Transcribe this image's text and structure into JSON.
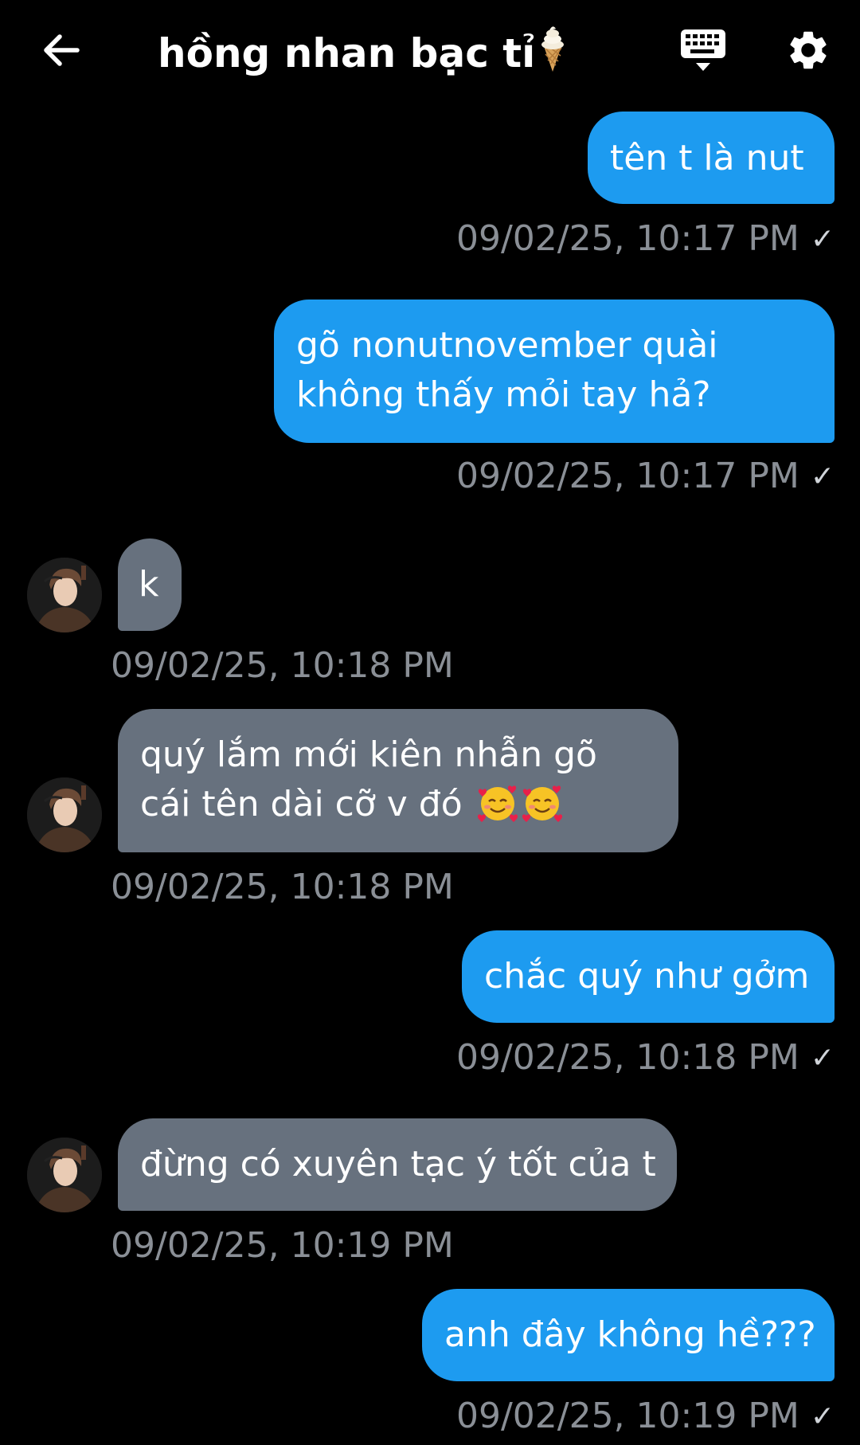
{
  "header": {
    "back_icon": "arrow-left-icon",
    "title": "hồng nhan bạc tỉ",
    "title_emoji": "soft-ice-cream-icon",
    "keyboard_icon": "keyboard-icon",
    "settings_icon": "gear-icon"
  },
  "colors": {
    "background": "#000000",
    "sent_bubble": "#1d9bf0",
    "received_bubble": "#67717e",
    "timestamp": "#8a8f96"
  },
  "messages": [
    {
      "direction": "sent",
      "text": "tên t là nut",
      "time": "09/02/25, 10:17 PM",
      "read_check": "✓"
    },
    {
      "direction": "sent",
      "line1": "gõ nonutnovember quài",
      "line2": "không thấy mỏi tay hả?",
      "time": "09/02/25, 10:17 PM",
      "read_check": "✓"
    },
    {
      "direction": "received",
      "text": "k",
      "time": "09/02/25, 10:18 PM"
    },
    {
      "direction": "received",
      "line1": "quý lắm mới kiên nhẫn gõ",
      "line2": "cái tên dài cỡ v đó",
      "emojis": [
        "smiling-face-with-hearts-icon",
        "smiling-face-with-hearts-icon"
      ],
      "time": "09/02/25, 10:18 PM"
    },
    {
      "direction": "sent",
      "text": "chắc quý như gởm",
      "time": "09/02/25, 10:18 PM",
      "read_check": "✓"
    },
    {
      "direction": "received",
      "text": "đừng có xuyên tạc ý tốt của t",
      "time": "09/02/25, 10:19 PM"
    },
    {
      "direction": "sent",
      "text": "anh đây không hề???",
      "time": "09/02/25, 10:19 PM",
      "read_check": "✓"
    }
  ]
}
